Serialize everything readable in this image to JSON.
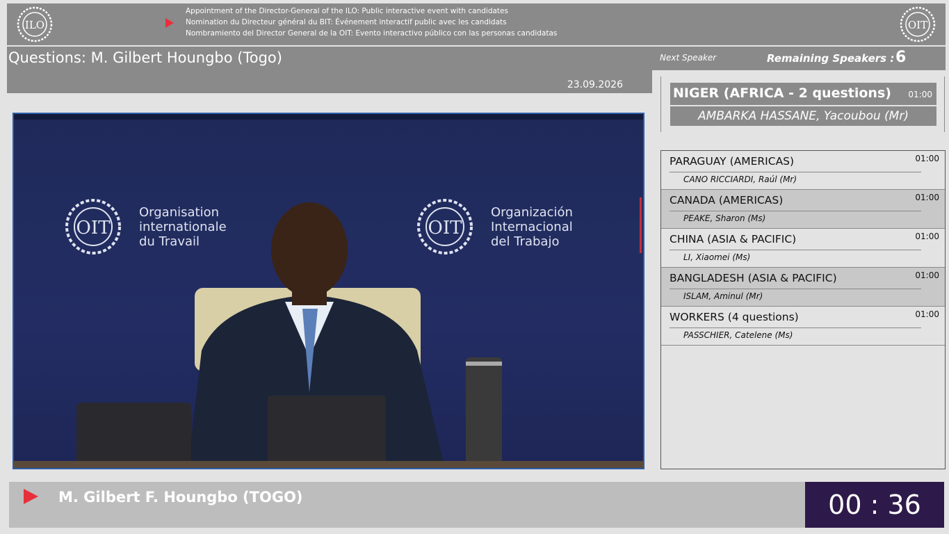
{
  "header": {
    "lines": [
      "Appointment of the Director-General of the ILO: Public interactive event with candidates",
      "Nomination du Directeur général du BIT: Événement interactif public avec les candidats",
      "Nombramiento del Director General de la OIT: Evento interactivo público con las personas candidatas"
    ],
    "left_logo": "ILO",
    "right_logo": "OIT"
  },
  "title": "Questions: M. Gilbert Houngbo (Togo)",
  "date": "23.09.2026",
  "next_speaker_label": "Next Speaker",
  "remaining_label": "Remaining Speakers :",
  "remaining_count": "6",
  "current": {
    "country": "NIGER  (AFRICA - 2 questions)",
    "time": "01:00",
    "person": "AMBARKA HASSANE, Yacoubou (Mr)"
  },
  "video": {
    "brand_fr": [
      "Organisation",
      "internationale",
      "du Travail"
    ],
    "brand_es": [
      "Organización",
      "Internacional",
      "del Trabajo"
    ],
    "logo_text": "OIT"
  },
  "speakers": [
    {
      "country": "PARAGUAY  (AMERICAS)",
      "person": "CANO RICCIARDI, Raúl (Mr)",
      "time": "01:00"
    },
    {
      "country": "CANADA  (AMERICAS)",
      "person": "PEAKE, Sharon (Ms)",
      "time": "01:00"
    },
    {
      "country": "CHINA  (ASIA & PACIFIC)",
      "person": "LI, Xiaomei (Ms)",
      "time": "01:00"
    },
    {
      "country": "BANGLADESH  (ASIA & PACIFIC)",
      "person": "ISLAM, Aminul (Mr)",
      "time": "01:00"
    },
    {
      "country": "WORKERS  (4 questions)",
      "person": "PASSCHIER, Catelene (Ms)",
      "time": "01:00"
    }
  ],
  "bottom": {
    "speaker_name": "M. Gilbert F. Houngbo  (TOGO)",
    "timer": "00 : 36"
  },
  "colors": {
    "panel_gray": "#8a8a8a",
    "accent_red": "#e8303c",
    "timer_bg": "#2e1a4a",
    "video_border": "#2c5ea8",
    "video_bg": "#232d63"
  }
}
